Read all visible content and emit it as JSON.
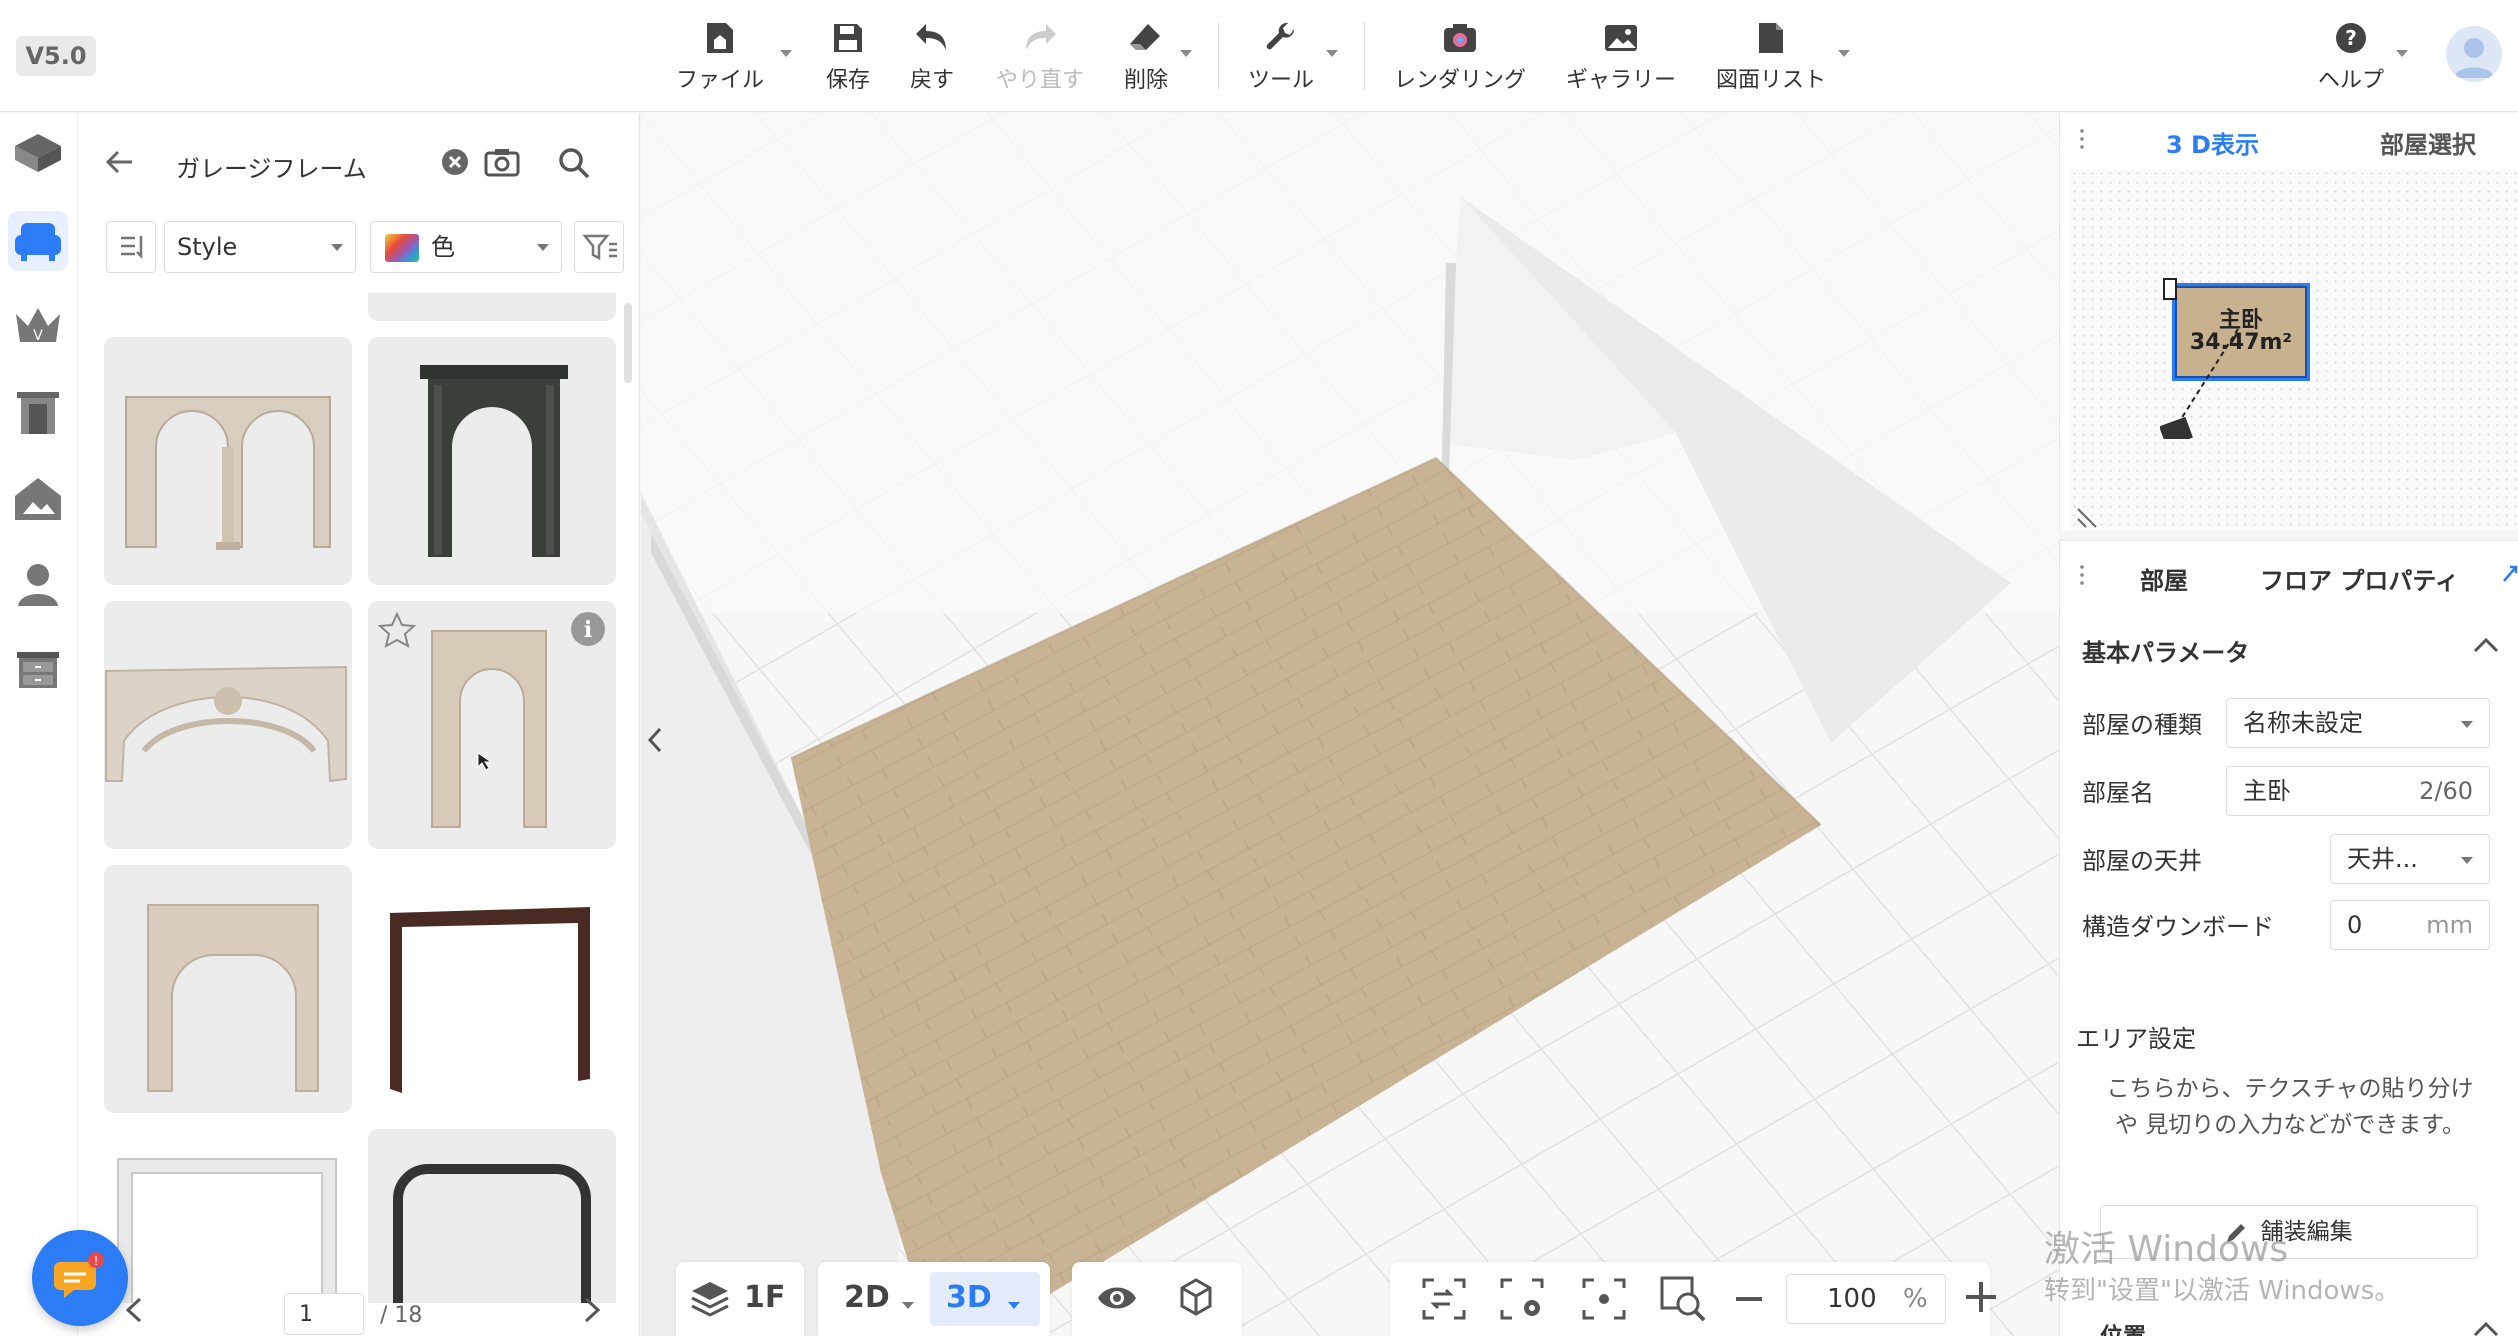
{
  "app": {
    "version": "V5.0"
  },
  "toolbar": {
    "file": "ファイル",
    "save": "保存",
    "undo": "戻す",
    "redo": "やり直す",
    "delete": "削除",
    "tools": "ツール",
    "rendering": "レンダリング",
    "gallery": "ギャラリー",
    "drawing_list": "図面リスト",
    "help": "ヘルプ"
  },
  "sidebar": {
    "items": [
      {
        "icon": "floorplan-icon"
      },
      {
        "icon": "furniture-icon",
        "active": true
      },
      {
        "icon": "crown-icon"
      },
      {
        "icon": "door-icon"
      },
      {
        "icon": "building-icon"
      },
      {
        "icon": "person-icon"
      },
      {
        "icon": "cabinet-icon"
      }
    ]
  },
  "catalog": {
    "search_text": "ガレージフレーム",
    "style_filter": "Style",
    "color_filter": "色",
    "page_current": "1",
    "page_total": "/ 18",
    "items": [
      {
        "name": "double-arch-frame",
        "color": "#d9cfc0"
      },
      {
        "name": "dark-ornate-arch-frame",
        "color": "#3a3f3a"
      },
      {
        "name": "carved-arch-frame",
        "color": "#dcd3c7"
      },
      {
        "name": "simple-arch-frame",
        "color": "#d7cab8"
      },
      {
        "name": "square-arch-frame",
        "color": "#dacdbd"
      },
      {
        "name": "dark-wood-frame",
        "color": "#4a2b24"
      },
      {
        "name": "white-square-frame",
        "color": "#e9e9e9"
      },
      {
        "name": "black-rounded-frame",
        "color": "#333333"
      }
    ]
  },
  "view": {
    "floor": "1F",
    "mode_2d": "2D",
    "mode_3d": "3D",
    "zoom": "100",
    "zoom_unit": "%"
  },
  "minimap": {
    "tab_3d": "3 D表示",
    "tab_room": "部屋選択",
    "room_name": "主卧",
    "room_area": "34.47m²"
  },
  "properties": {
    "tab_room": "部屋",
    "tab_floor": "フロア プロパティ",
    "section_title": "基本パラメータ",
    "room_type_label": "部屋の種類",
    "room_type_value": "名称未設定",
    "room_name_label": "部屋名",
    "room_name_value": "主卧",
    "room_name_count": "2/60",
    "ceiling_label": "部屋の天井",
    "ceiling_value": "天井...",
    "downboard_label": "構造ダウンボード",
    "downboard_value": "0",
    "downboard_unit": "mm",
    "area_title": "エリア設定",
    "area_desc": "こちらから、テクスチャの貼り分けや 見切りの入力などができます。",
    "paving_button": "舗装編集",
    "position_title": "位置"
  },
  "watermark": {
    "line1": "激活 Windows",
    "line2": "转到\"设置\"以激活 Windows。"
  },
  "colors": {
    "accent": "#2b7cf5",
    "floor": "#c9b395",
    "room_fill": "#c8b18e"
  }
}
